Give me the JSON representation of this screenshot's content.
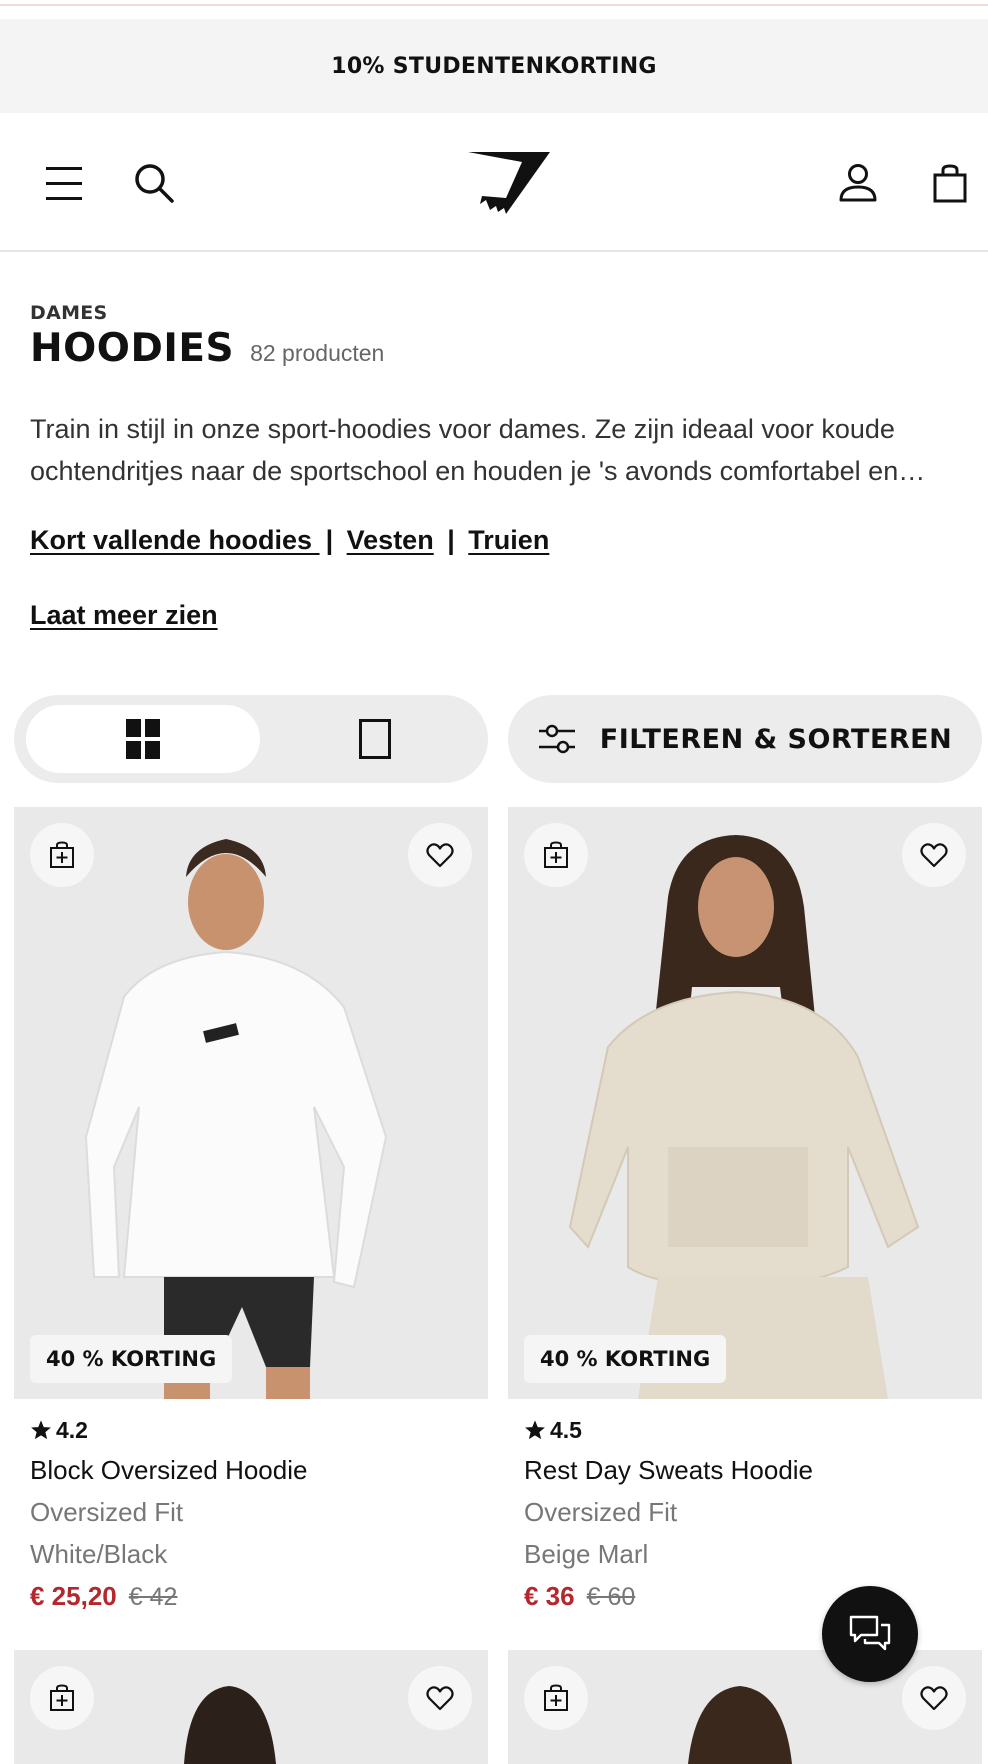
{
  "promo": {
    "text": "10% STUDENTENKORTING"
  },
  "header": {
    "icons": [
      "hamburger-menu-icon",
      "search-icon",
      "gymshark-logo",
      "account-icon",
      "bag-icon"
    ]
  },
  "category": {
    "breadcrumb": "DAMES",
    "title": "HOODIES",
    "count": "82 producten",
    "description": "Train in stijl in onze sport-hoodies voor dames. Ze zijn ideaal voor koude ochtendritjes naar de sportschool en houden je 's avonds comfortabel en warm.",
    "links": [
      "Kort vallende hoodies ",
      "Vesten",
      "Truien"
    ],
    "separator": "|",
    "show_more": "Laat meer zien"
  },
  "toolbar": {
    "view_options": [
      "grid-view-icon",
      "single-view-icon"
    ],
    "filter_label": "FILTEREN & SORTEREN"
  },
  "products": [
    {
      "badge": "40 % KORTING",
      "rating": "4.2",
      "name": "Block Oversized Hoodie",
      "fit": "Oversized Fit",
      "colour": "White/Black",
      "price": "€ 25,20",
      "old_price": "€ 42",
      "image_colour": "#f7f7f7"
    },
    {
      "badge": "40 % KORTING",
      "rating": "4.5",
      "name": "Rest Day Sweats Hoodie",
      "fit": "Oversized Fit",
      "colour": "Beige Marl",
      "price": "€ 36",
      "old_price": "€ 60",
      "image_colour": "#e6dfd2"
    }
  ],
  "colors": {
    "accent_price": "#b3272d",
    "panel_bg": "#ececec",
    "image_bg": "#e9e9e9"
  }
}
